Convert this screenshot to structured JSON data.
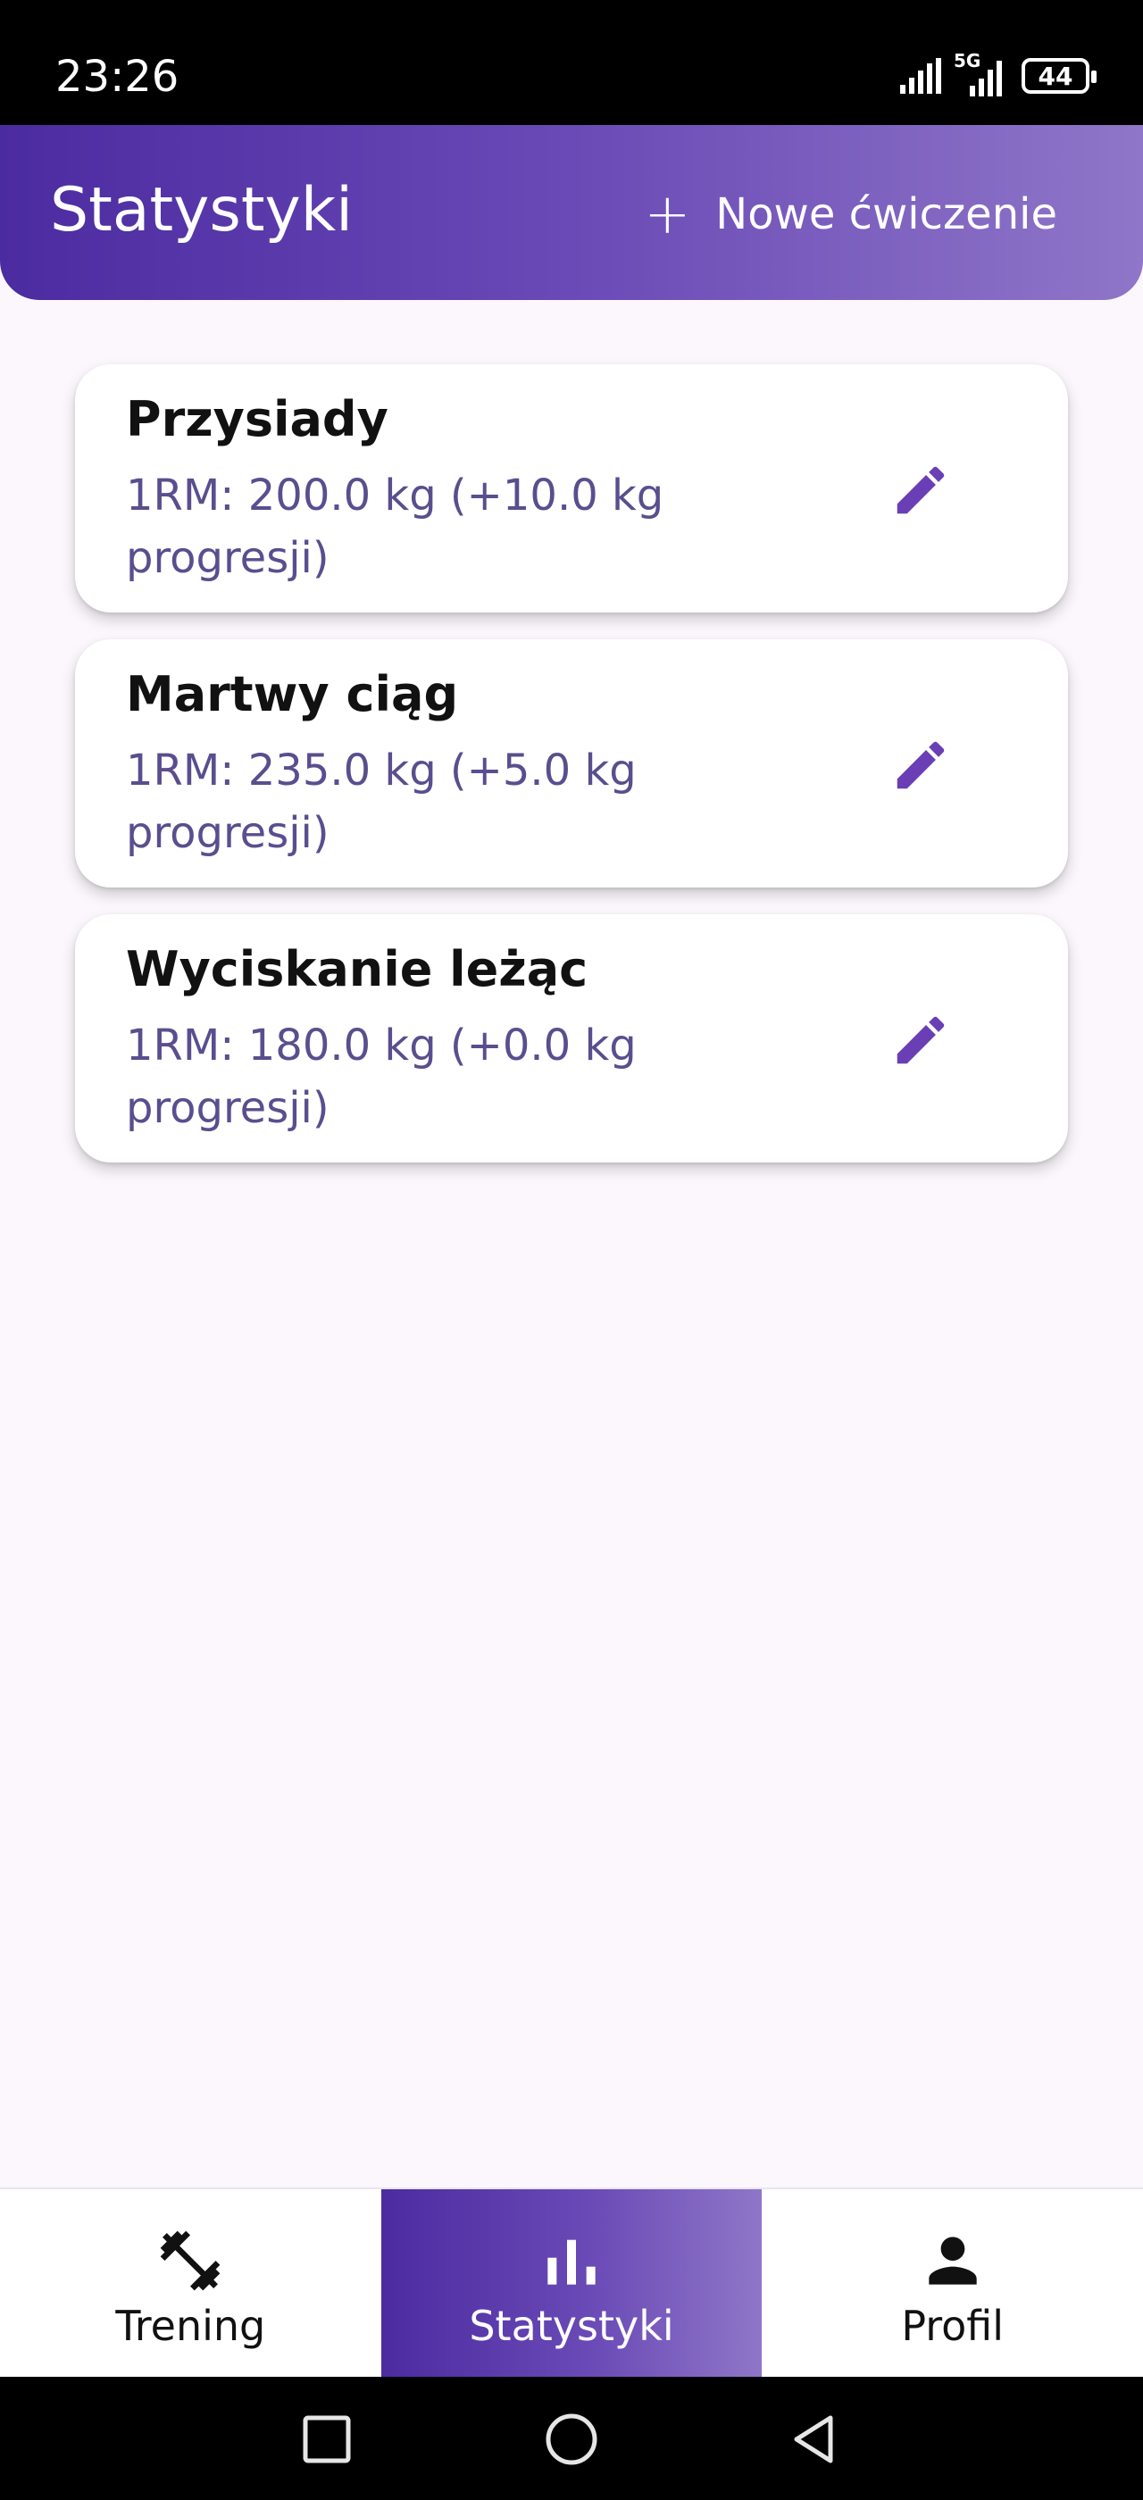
{
  "status_bar": {
    "time": "23:26",
    "network": "5G",
    "battery": "44"
  },
  "app_bar": {
    "title": "Statystyki",
    "new_button_label": "Nowe ćwiczenie",
    "plus_glyph": "+"
  },
  "exercises": [
    {
      "name": "Przysiady",
      "stat": "1RM: 200.0 kg (+10.0 kg progresji)"
    },
    {
      "name": "Martwy ciąg",
      "stat": "1RM: 235.0 kg (+5.0 kg progresji)"
    },
    {
      "name": "Wyciskanie leżąc",
      "stat": "1RM: 180.0 kg (+0.0 kg progresji)"
    }
  ],
  "bottom_nav": [
    {
      "label": "Trening",
      "icon": "dumbbell-icon",
      "active": false
    },
    {
      "label": "Statystyki",
      "icon": "bar-chart-icon",
      "active": true
    },
    {
      "label": "Profil",
      "icon": "person-icon",
      "active": false
    }
  ],
  "colors": {
    "accent": "#6a4ab6",
    "accent_dark": "#4b2ba0",
    "accent_light": "#8f76c8",
    "stat_text": "#5a4e8e",
    "background": "#fbf7fc"
  }
}
